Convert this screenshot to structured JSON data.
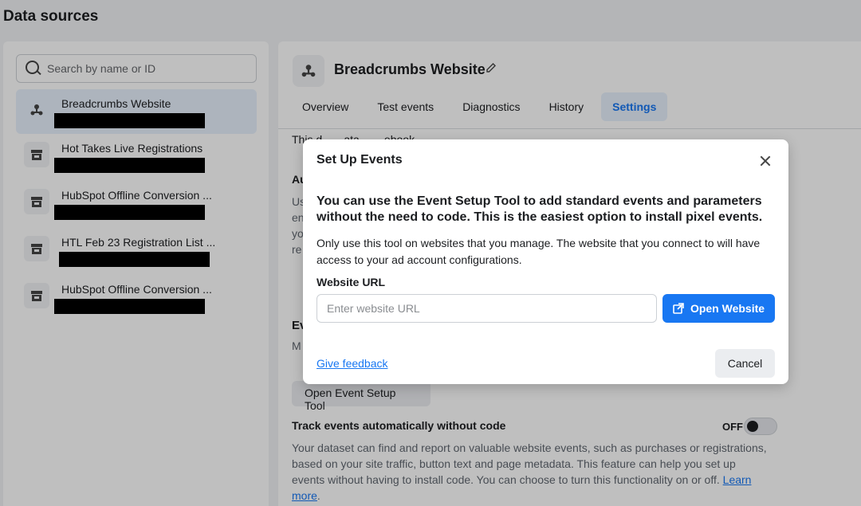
{
  "page": {
    "title": "Data sources"
  },
  "search": {
    "placeholder": "Search by name or ID"
  },
  "sources": [
    {
      "name": "Breadcrumbs Website",
      "icon": "pixel-icon",
      "active": true
    },
    {
      "name": "Hot Takes Live Registrations",
      "icon": "store-icon"
    },
    {
      "name": "HubSpot Offline Conversion ...",
      "icon": "store-icon"
    },
    {
      "name": "HTL Feb 23 Registration List ...",
      "icon": "store-icon"
    },
    {
      "name": "HubSpot Offline Conversion ...",
      "icon": "store-icon"
    }
  ],
  "detail": {
    "title": "Breadcrumbs Website",
    "tabs": [
      "Overview",
      "Test events",
      "Diagnostics",
      "History",
      "Settings"
    ],
    "active_tab": "Settings",
    "bg_fragments": {
      "line1": "This d... ...ata ... ...ebook...",
      "au": "Au",
      "us": "Us",
      "en": "en",
      "yo": "yo",
      "re": "re",
      "ev": "Ev",
      "m": "M"
    },
    "open_event_setup_button": "Open Event Setup Tool",
    "track_title": "Track events automatically without code",
    "toggle_state": "OFF",
    "track_desc": "Your dataset can find and report on valuable website events, such as purchases or registrations, based on your site traffic, button text and page metadata. This feature can help you set up events without having to install code. You can choose to turn this functionality on or off.",
    "learn_more": "Learn more"
  },
  "modal": {
    "title": "Set Up Events",
    "headline": "You can use the Event Setup Tool to add standard events and parameters without the need to code. This is the easiest option to install pixel events.",
    "body": "Only use this tool on websites that you manage. The website that you connect to will have access to your ad account configurations.",
    "url_label": "Website URL",
    "url_placeholder": "Enter website URL",
    "open_button": "Open Website",
    "feedback_link": "Give feedback",
    "cancel_button": "Cancel"
  },
  "colors": {
    "accent": "#1877f2",
    "active_bg": "#e7f0fd"
  }
}
